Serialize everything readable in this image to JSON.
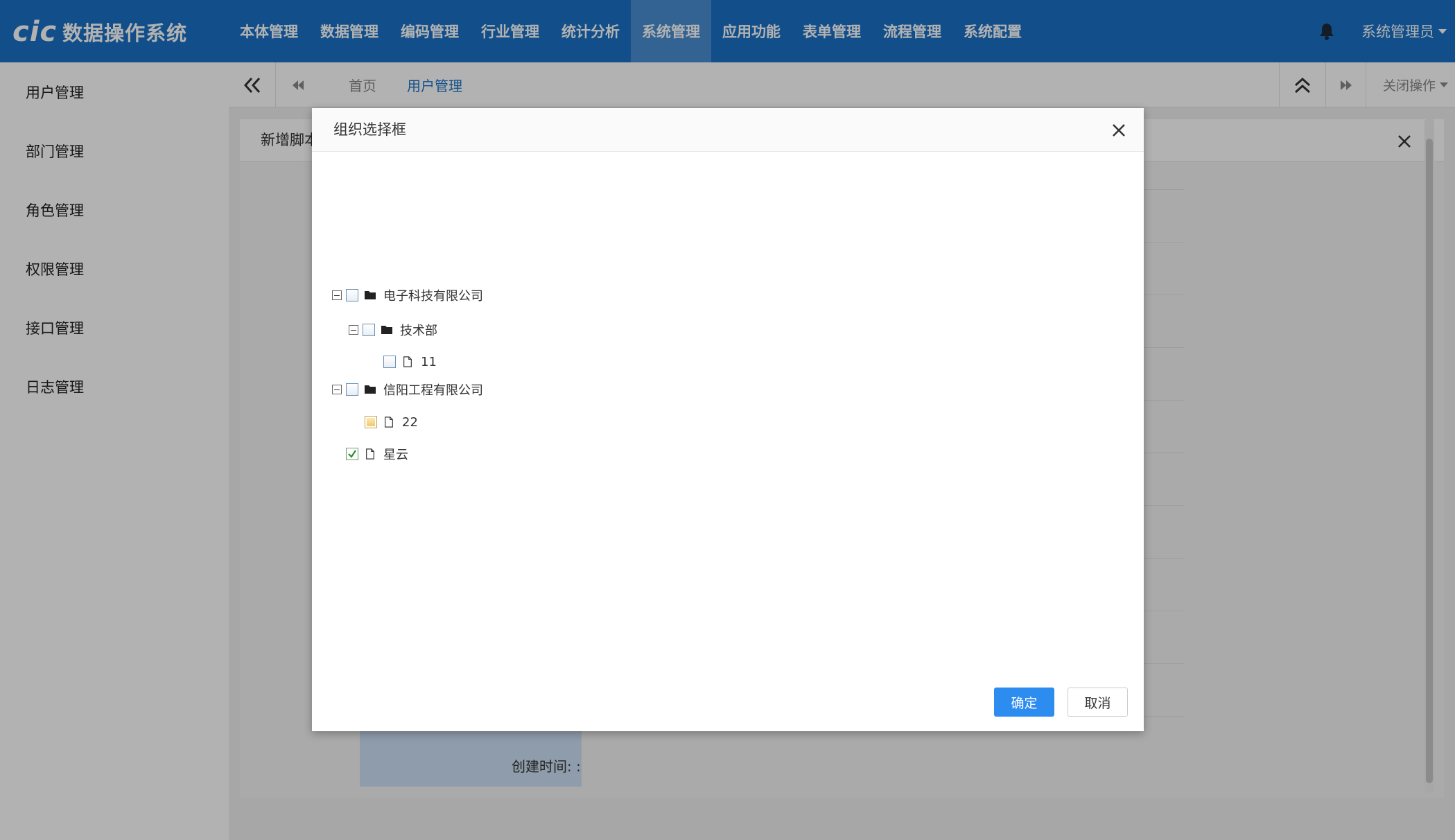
{
  "header": {
    "logo_brand": "cic",
    "logo_text": "数据操作系统",
    "nav": [
      {
        "label": "本体管理",
        "active": false
      },
      {
        "label": "数据管理",
        "active": false
      },
      {
        "label": "编码管理",
        "active": false
      },
      {
        "label": "行业管理",
        "active": false
      },
      {
        "label": "统计分析",
        "active": false
      },
      {
        "label": "系统管理",
        "active": true
      },
      {
        "label": "应用功能",
        "active": false
      },
      {
        "label": "表单管理",
        "active": false
      },
      {
        "label": "流程管理",
        "active": false
      },
      {
        "label": "系统配置",
        "active": false
      }
    ],
    "bell_icon": "bell-icon",
    "user": "系统管理员"
  },
  "sidebar": {
    "items": [
      {
        "label": "用户管理"
      },
      {
        "label": "部门管理"
      },
      {
        "label": "角色管理"
      },
      {
        "label": "权限管理"
      },
      {
        "label": "接口管理"
      },
      {
        "label": "日志管理"
      }
    ]
  },
  "tabbar": {
    "tabs": [
      {
        "label": "首页",
        "active": false
      },
      {
        "label": "用户管理",
        "active": true
      }
    ],
    "close_ops": "关闭操作"
  },
  "content": {
    "title": "新增脚本",
    "create_time_label": "创建时间: :"
  },
  "modal": {
    "title": "组织选择框",
    "tree": [
      {
        "label": "电子科技有限公司",
        "type": "folder",
        "expanded": true,
        "checked": "none",
        "level": 0
      },
      {
        "label": "技术部",
        "type": "folder",
        "expanded": true,
        "checked": "none",
        "level": 1
      },
      {
        "label": "11",
        "type": "file",
        "checked": "none",
        "level": 2
      },
      {
        "label": "信阳工程有限公司",
        "type": "folder",
        "expanded": true,
        "checked": "none",
        "level": 0
      },
      {
        "label": "22",
        "type": "file",
        "checked": "partial",
        "level": 1
      },
      {
        "label": "星云",
        "type": "file",
        "checked": "checked",
        "level": 0
      }
    ],
    "ok_label": "确定",
    "cancel_label": "取消"
  },
  "colors": {
    "topbar": "#1b72c6",
    "topbar_active": "#4a8fd3",
    "accent": "#2d8cf0"
  }
}
